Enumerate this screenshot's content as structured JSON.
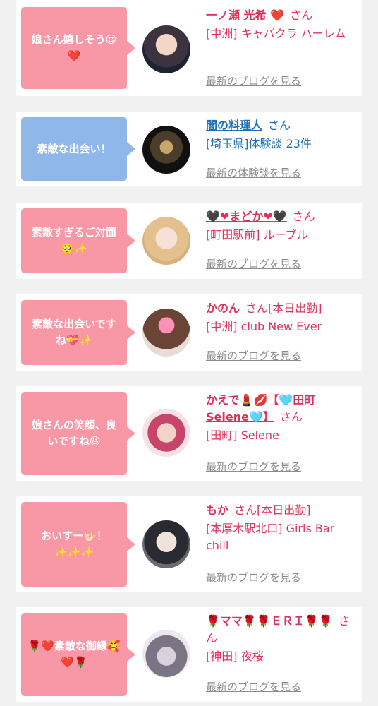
{
  "icons": {
    "heart": "❤️",
    "grin": "😍",
    "pleading": "🥺",
    "sparkles": "✨",
    "gift-heart": "💝",
    "smile": "😆",
    "rose": "🌹",
    "blue-heart": "🩵",
    "black-heart": "🖤",
    "lipstick": "💄",
    "kiss": "💋",
    "rock-hand": "🤟🏻"
  },
  "colors": {
    "pink_bubble": "#f898a7",
    "blue_bubble": "#8fb7ea",
    "name_pink": "#e0305a",
    "name_blue": "#1f6fb8"
  },
  "entries": [
    {
      "comment": "娘さん嬉しそう😍❤️",
      "name": "一ノ瀬 光希 ❤️",
      "honorific": "さん",
      "status": "",
      "shop": "[中洲] キャバクラ ハーレム",
      "link": "最新のブログを見る"
    },
    {
      "comment": "素敵な出会い！",
      "name": "闇の料理人",
      "honorific": "さん",
      "status": "",
      "shop": "[埼玉県]体験談 23件",
      "link": "最新の体験談を見る"
    },
    {
      "comment": "素敵すぎるご対面🥺✨",
      "name": "🖤❤まどか❤🖤",
      "honorific": "さん",
      "status": "",
      "shop": "[町田駅前] ルーブル",
      "link": "最新のブログを見る"
    },
    {
      "comment": "素敵な出会いですね💝✨",
      "name": "かのん",
      "honorific": "さん",
      "status": "[本日出勤]",
      "shop": "[中洲] club New Ever",
      "link": "最新のブログを見る"
    },
    {
      "comment": "娘さんの笑顔、良いですね😆",
      "name": "かえで💄💋【🩵田町Selene🩵】",
      "honorific": "さん",
      "status": "",
      "shop": "[田町] Selene",
      "link": "最新のブログを見る"
    },
    {
      "comment": "おいすー🤟🏻！✨✨✨",
      "name": "もか",
      "honorific": "さん",
      "status": "[本日出勤]",
      "shop": "[本厚木駅北口] Girls Bar chill",
      "link": "最新のブログを見る"
    },
    {
      "comment": "🌹❤️素敵な御縁🥰❤️🌹",
      "name": "🌹ママ🌹🌹ＥＲＩ🌹🌹",
      "honorific": "さん",
      "status": "",
      "shop": "[神田] 夜桜",
      "link": "最新のブログを見る"
    }
  ]
}
